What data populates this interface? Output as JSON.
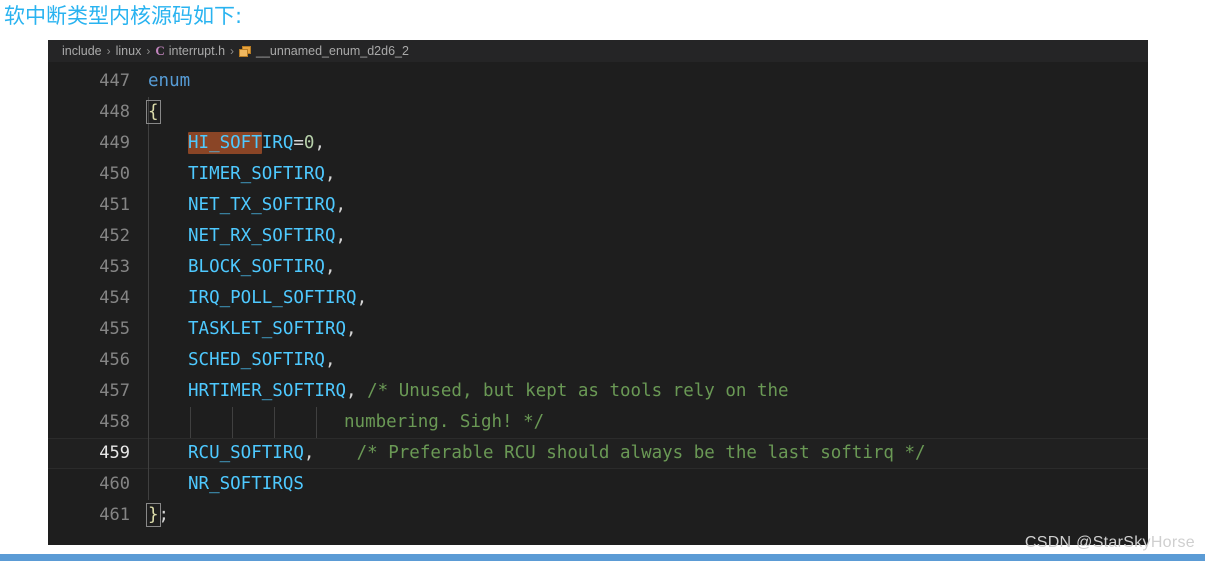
{
  "heading": "软中断类型内核源码如下:",
  "accent_colors": {
    "heading": "#29b3f0",
    "bottom_rule": "#5b9bd5",
    "editor_background": "#1e1e1e",
    "breadcrumb_background": "#252526",
    "identifier": "#4ec9ff",
    "keyword": "#569cd6",
    "comment": "#6a9955",
    "number": "#b5cea8",
    "selection_highlight": "#8a4526"
  },
  "breadcrumb": {
    "separator": "›",
    "items": [
      {
        "label": "include",
        "icon": ""
      },
      {
        "label": "linux",
        "icon": ""
      },
      {
        "label": "interrupt.h",
        "icon": "c-file-icon"
      },
      {
        "label": "__unnamed_enum_d2d6_2",
        "icon": "enum-icon"
      }
    ]
  },
  "editor": {
    "active_line": 459,
    "lines": [
      {
        "no": "447",
        "text": "enum"
      },
      {
        "no": "448",
        "text": "{"
      },
      {
        "no": "449",
        "text": "    HI_SOFTIRQ=0,"
      },
      {
        "no": "450",
        "text": "    TIMER_SOFTIRQ,"
      },
      {
        "no": "451",
        "text": "    NET_TX_SOFTIRQ,"
      },
      {
        "no": "452",
        "text": "    NET_RX_SOFTIRQ,"
      },
      {
        "no": "453",
        "text": "    BLOCK_SOFTIRQ,"
      },
      {
        "no": "454",
        "text": "    IRQ_POLL_SOFTIRQ,"
      },
      {
        "no": "455",
        "text": "    TASKLET_SOFTIRQ,"
      },
      {
        "no": "456",
        "text": "    SCHED_SOFTIRQ,"
      },
      {
        "no": "457",
        "text": "    HRTIMER_SOFTIRQ, /* Unused, but kept as tools rely on the"
      },
      {
        "no": "458",
        "text": "                numbering. Sigh! */"
      },
      {
        "no": "459",
        "text": "    RCU_SOFTIRQ,    /* Preferable RCU should always be the last softirq */"
      },
      {
        "no": "460",
        "text": "    NR_SOFTIRQS"
      },
      {
        "no": "461",
        "text": "};"
      }
    ],
    "tokens": {
      "l447_keyword": "enum",
      "l448_brace": "{",
      "l449_sel": "HI_SOFT",
      "l449_rest": "IRQ",
      "l449_eq": "=",
      "l449_num": "0",
      "l449_comma": ",",
      "l450_ident": "TIMER_SOFTIRQ",
      "l451_ident": "NET_TX_SOFTIRQ",
      "l452_ident": "NET_RX_SOFTIRQ",
      "l453_ident": "BLOCK_SOFTIRQ",
      "l454_ident": "IRQ_POLL_SOFTIRQ",
      "l455_ident": "TASKLET_SOFTIRQ",
      "l456_ident": "SCHED_SOFTIRQ",
      "l457_ident": "HRTIMER_SOFTIRQ",
      "l457_comment": "/* Unused, but kept as tools rely on the",
      "l458_comment": "numbering. Sigh! */",
      "l459_ident": "RCU_SOFTIRQ",
      "l459_comment": "/* Preferable RCU should always be the last softirq */",
      "l460_ident": "NR_SOFTIRQS",
      "l461_brace": "}",
      "l461_semi": ";",
      "comma": ","
    }
  },
  "watermark": "CSDN @StarSkyHorse"
}
